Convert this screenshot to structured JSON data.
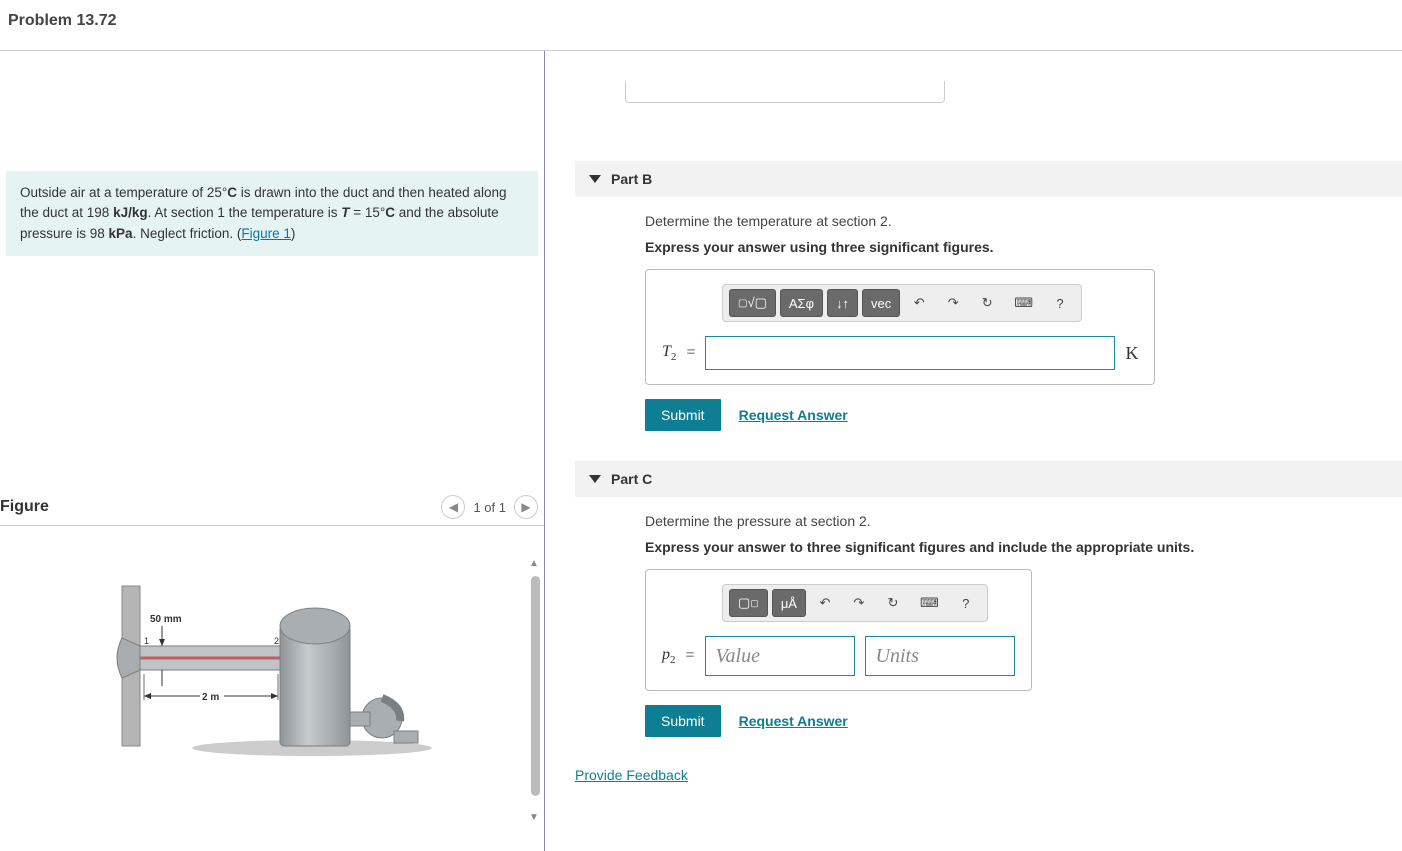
{
  "header": {
    "title": "Problem 13.72"
  },
  "problem_statement_html": "Outside air at a temperature of 25° C is drawn into the duct and then heated along the duct at 198 kJ/kg. At section 1 the temperature is T = 15° C and the absolute pressure is 98 kPa. Neglect friction.",
  "problem_bold": {
    "temp25": "C",
    "rate": "kJ/kg",
    "T": "T",
    "temp15": "C",
    "press": "kPa"
  },
  "figure_link": "Figure 1",
  "figure": {
    "title": "Figure",
    "pager": "1 of 1",
    "labels": {
      "diameter": "50 mm",
      "length": "2 m",
      "sec1": "1",
      "sec2": "2"
    }
  },
  "parts": {
    "b": {
      "title": "Part B",
      "prompt": "Determine the temperature at section 2.",
      "instruction": "Express your answer using three significant figures.",
      "var": "T",
      "sub": "2",
      "unit": "K",
      "toolbar": {
        "templates": "▢√▢",
        "greek": "ΑΣφ",
        "updown": "↓↑",
        "vec": "vec",
        "undo": "↶",
        "redo": "↷",
        "reset": "↻",
        "keyboard": "⌨",
        "help": "?"
      },
      "submit": "Submit",
      "request": "Request Answer"
    },
    "c": {
      "title": "Part C",
      "prompt": "Determine the pressure at section 2.",
      "instruction": "Express your answer to three significant figures and include the appropriate units.",
      "var": "p",
      "sub": "2",
      "value_placeholder": "Value",
      "units_placeholder": "Units",
      "toolbar": {
        "templates": "▢▢",
        "units": "μÅ",
        "undo": "↶",
        "redo": "↷",
        "reset": "↻",
        "keyboard": "⌨",
        "help": "?"
      },
      "submit": "Submit",
      "request": "Request Answer"
    }
  },
  "feedback_link": "Provide Feedback"
}
